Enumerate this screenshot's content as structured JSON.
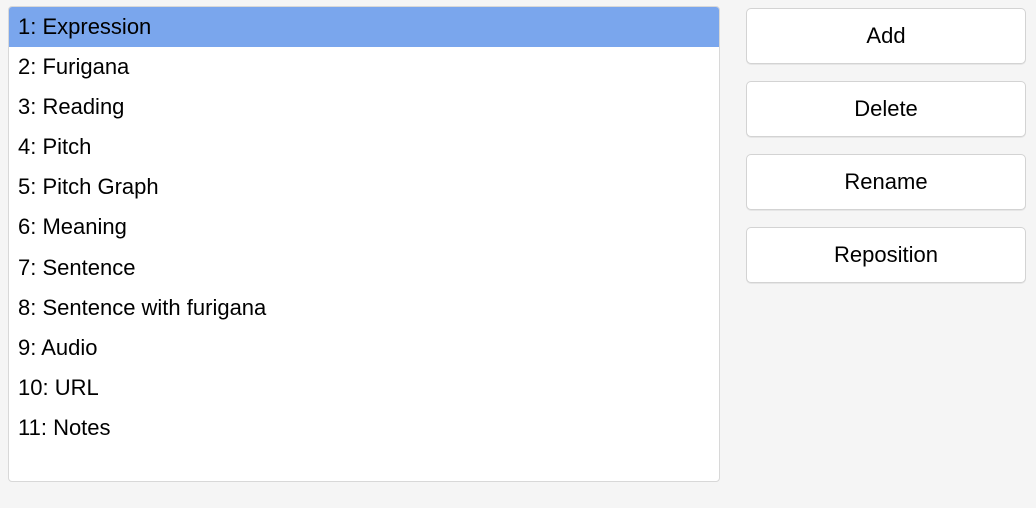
{
  "fields": [
    {
      "index": 1,
      "name": "Expression",
      "selected": true
    },
    {
      "index": 2,
      "name": "Furigana",
      "selected": false
    },
    {
      "index": 3,
      "name": "Reading",
      "selected": false
    },
    {
      "index": 4,
      "name": "Pitch",
      "selected": false
    },
    {
      "index": 5,
      "name": "Pitch Graph",
      "selected": false
    },
    {
      "index": 6,
      "name": "Meaning",
      "selected": false
    },
    {
      "index": 7,
      "name": "Sentence",
      "selected": false
    },
    {
      "index": 8,
      "name": "Sentence with furigana",
      "selected": false
    },
    {
      "index": 9,
      "name": "Audio",
      "selected": false
    },
    {
      "index": 10,
      "name": "URL",
      "selected": false
    },
    {
      "index": 11,
      "name": "Notes",
      "selected": false
    }
  ],
  "buttons": {
    "add": "Add",
    "delete": "Delete",
    "rename": "Rename",
    "reposition": "Reposition"
  }
}
